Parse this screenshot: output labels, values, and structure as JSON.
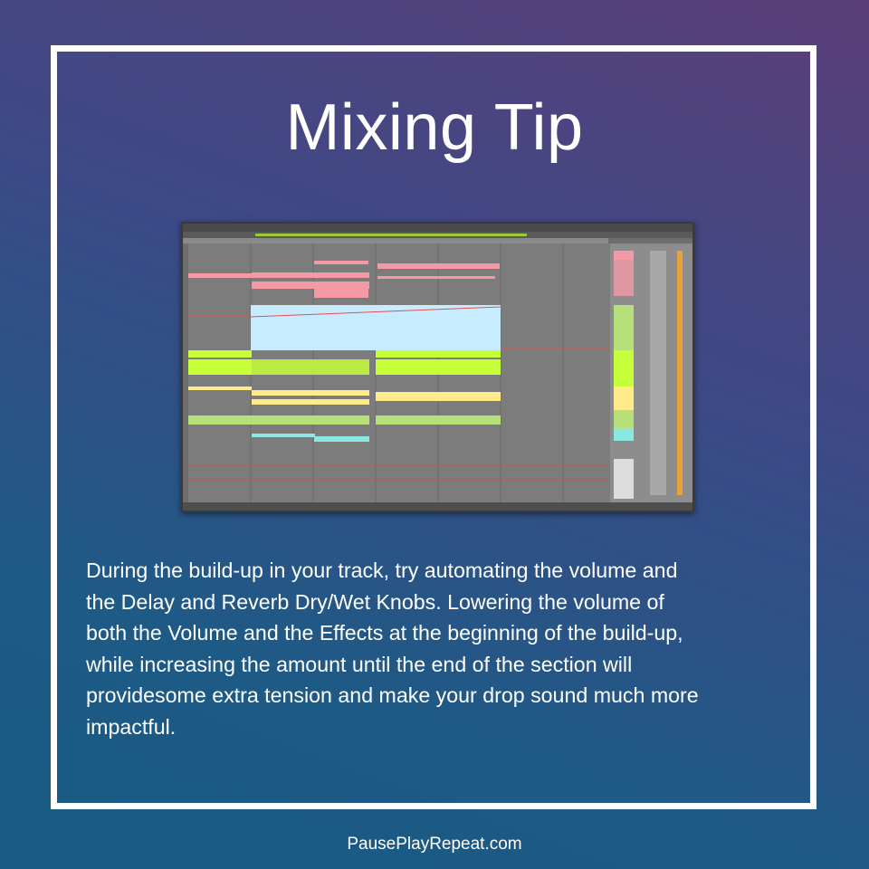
{
  "title": "Mixing Tip",
  "body_lines": [
    "During the build-up in your track, try automating the volume and",
    "the Delay and Reverb Dry/Wet Knobs. Lowering the volume of",
    "both the Volume and the Effects at the beginning of the build-up,",
    "while increasing the amount until the end of the section will",
    "providesome extra tension and make your drop sound much more",
    "impactful."
  ],
  "footer": "PausePlayRepeat.com",
  "screenshot": {
    "description_icon": "daw-arrangement-view",
    "clip_colors": [
      "#f49aa6",
      "#c6ff3a",
      "#ffeb8a",
      "#b8f07a",
      "#c8ecff",
      "#8be8e0"
    ]
  }
}
